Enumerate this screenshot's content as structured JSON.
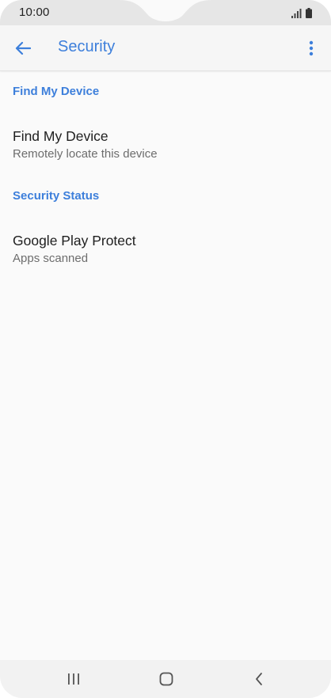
{
  "status_bar": {
    "time": "10:00",
    "signal_icon": "signal-icon",
    "battery_icon": "battery-icon"
  },
  "app_bar": {
    "title": "Security",
    "back_icon": "back-arrow-icon",
    "overflow_icon": "more-vert-icon"
  },
  "sections": [
    {
      "header": "Find My Device",
      "items": [
        {
          "title": "Find My Device",
          "subtitle": "Remotely locate this device"
        }
      ]
    },
    {
      "header": "Security Status",
      "items": [
        {
          "title": "Google Play Protect",
          "subtitle": "Apps scanned"
        }
      ]
    }
  ],
  "nav_bar": {
    "recents_icon": "recent-apps-icon",
    "home_icon": "home-icon",
    "back_icon": "back-icon"
  },
  "colors": {
    "accent": "#3d7fdb",
    "background": "#fafafa",
    "primary_text": "#202020",
    "secondary_text": "#6d6d6d"
  }
}
